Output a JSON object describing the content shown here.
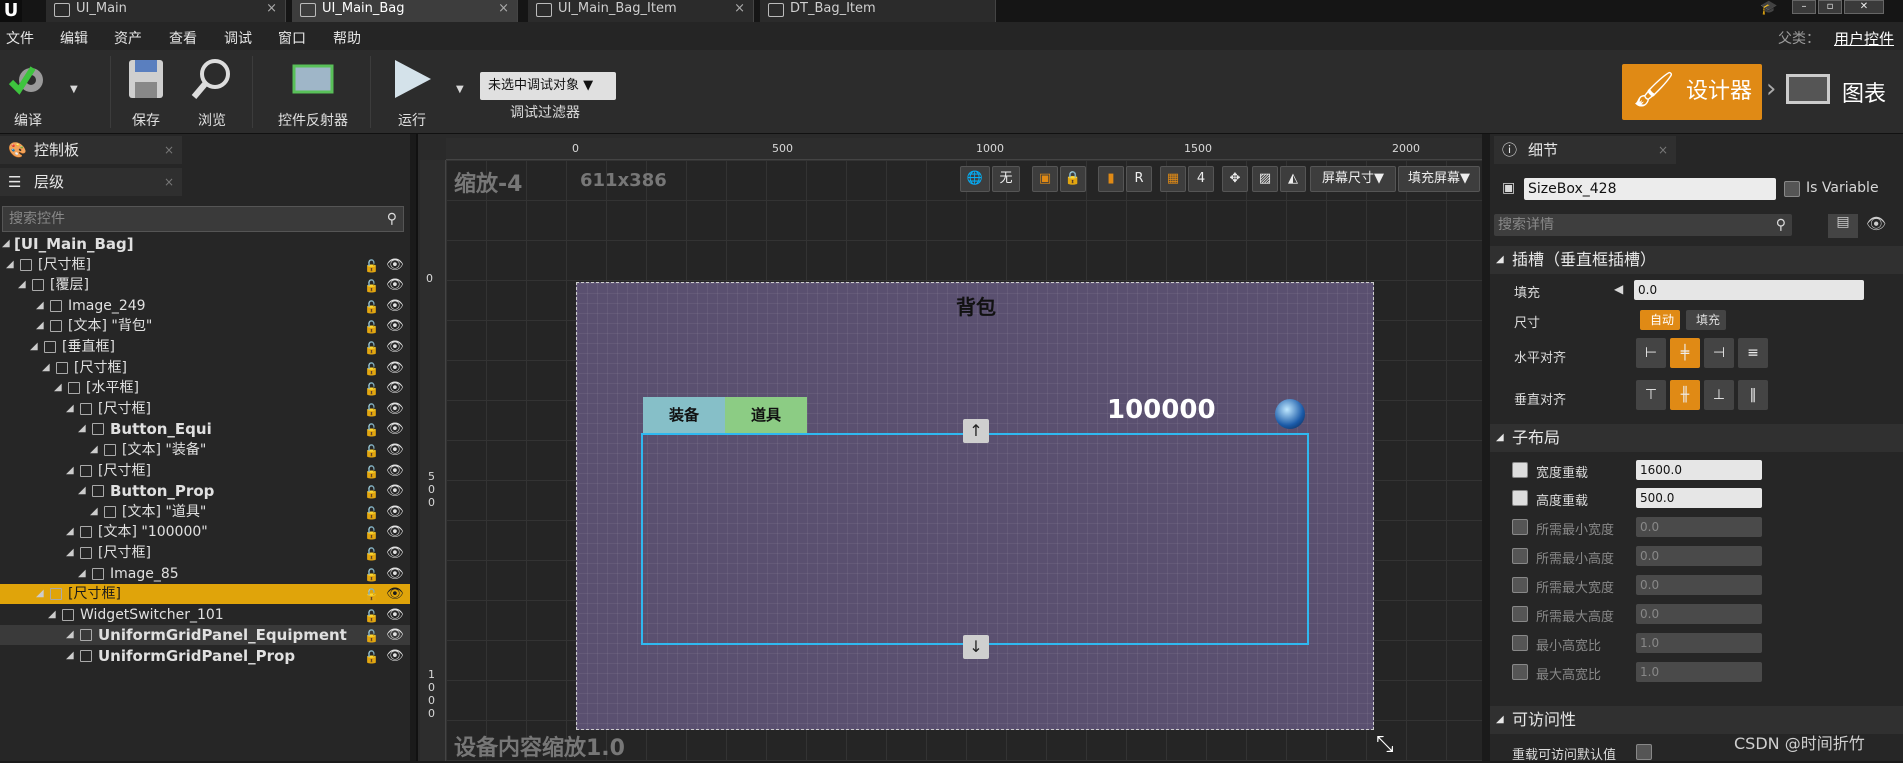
{
  "tabs": [
    {
      "label": "UI_Main"
    },
    {
      "label": "UI_Main_Bag"
    },
    {
      "label": "UI_Main_Bag_Item"
    },
    {
      "label": "DT_Bag_Item"
    }
  ],
  "parent_label": "父类：",
  "parent_value": "用户控件",
  "menu": [
    "文件",
    "编辑",
    "资产",
    "查看",
    "调试",
    "窗口",
    "帮助"
  ],
  "toolbar": {
    "compile": "编译",
    "save": "保存",
    "browse": "浏览",
    "reflector": "控件反射器",
    "run": "运行",
    "debug_select": "未选中调试对象",
    "debug_filter": "调试过滤器",
    "designer": "设计器",
    "graph": "图表"
  },
  "left": {
    "palette_tab": "控制板",
    "hierarchy_tab": "层级",
    "search_placeholder": "搜索控件",
    "tree": [
      {
        "label": "[UI_Main_Bag]",
        "bold": true
      },
      {
        "label": "[尺寸框]"
      },
      {
        "label": "[覆层]"
      },
      {
        "label": "Image_249"
      },
      {
        "label": "[文本] \"背包\""
      },
      {
        "label": "[垂直框]"
      },
      {
        "label": "[尺寸框]"
      },
      {
        "label": "[水平框]"
      },
      {
        "label": "[尺寸框]"
      },
      {
        "label": "Button_Equi",
        "bold": true
      },
      {
        "label": "[文本] \"装备\""
      },
      {
        "label": "[尺寸框]"
      },
      {
        "label": "Button_Prop",
        "bold": true
      },
      {
        "label": "[文本] \"道具\""
      },
      {
        "label": "[文本] \"100000\""
      },
      {
        "label": "[尺寸框]"
      },
      {
        "label": "Image_85"
      },
      {
        "label": "[尺寸框]",
        "selected": true
      },
      {
        "label": "WidgetSwitcher_101"
      },
      {
        "label": "UniformGridPanel_Equipment",
        "bold": true
      },
      {
        "label": "UniformGridPanel_Prop",
        "bold": true
      }
    ]
  },
  "viewport": {
    "zoom": "缩放-4",
    "size": "611x386",
    "dpi_scale": "设备内容缩放1.0",
    "ruler_top": [
      "0",
      "500",
      "1000",
      "1500",
      "2000"
    ],
    "ruler_left": [
      "0",
      "5\n0\n0",
      "1\n0\n0\n0"
    ],
    "tool_none": "无",
    "tool_r": "R",
    "tool_grid": "4",
    "screen_size": "屏幕尺寸",
    "fill_screen": "填充屏幕",
    "bag_title": "背包",
    "tab_equip": "装备",
    "tab_prop": "道具",
    "gold": "100000",
    "arrow_up": "↑",
    "arrow_down": "↓"
  },
  "details": {
    "tab": "细节",
    "widget_name": "SizeBox_428",
    "is_variable": "Is Variable",
    "search_placeholder": "搜索详情",
    "slot_section": "插槽（垂直框插槽）",
    "padding_label": "填充",
    "padding_value": "0.0",
    "size_label": "尺寸",
    "size_auto": "自动",
    "size_fill": "填充",
    "halign_label": "水平对齐",
    "valign_label": "垂直对齐",
    "child_layout": "子布局",
    "width_override": "宽度重载",
    "width_value": "1600.0",
    "height_override": "高度重载",
    "height_value": "500.0",
    "min_desired_width": "所需最小宽度",
    "min_desired_width_value": "0.0",
    "min_desired_height": "所需最小高度",
    "min_desired_height_value": "0.0",
    "max_desired_width": "所需最大宽度",
    "max_desired_width_value": "0.0",
    "max_desired_height": "所需最大高度",
    "max_desired_height_value": "0.0",
    "min_aspect": "最小高宽比",
    "min_aspect_value": "1.0",
    "max_aspect": "最大高宽比",
    "max_aspect_value": "1.0",
    "accessibility": "可访问性",
    "override_access": "重载可访问默认值"
  },
  "watermark": "CSDN @时间折竹"
}
